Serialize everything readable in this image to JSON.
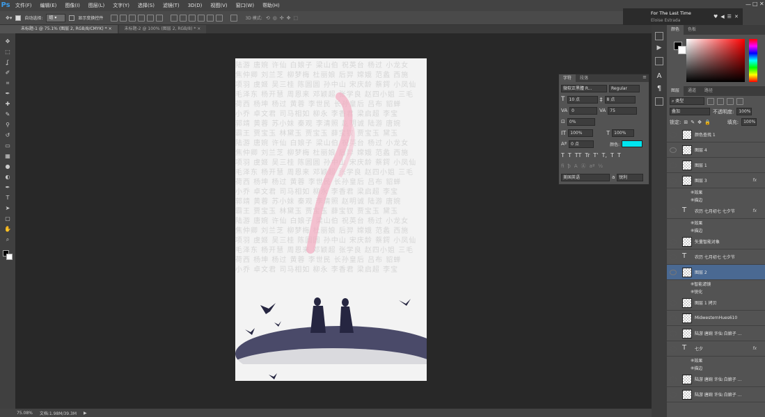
{
  "app_logo": "Ps",
  "menu": [
    "文件(F)",
    "编辑(E)",
    "图像(I)",
    "图层(L)",
    "文字(Y)",
    "选择(S)",
    "滤镜(T)",
    "3D(D)",
    "视图(V)",
    "窗口(W)",
    "帮助(H)"
  ],
  "options": {
    "auto_select_label": "自动选择:",
    "auto_select_value": "组",
    "transform_label": "显示变换控件",
    "mode3d_label": "3D 模式:"
  },
  "media": {
    "title": "For The Last Time",
    "artist": "Eloise Estrada"
  },
  "tabs": [
    {
      "label": "未标题-1 @ 75.1% (图层 2, RGB/8/CMYK) *",
      "close": "×"
    },
    {
      "label": "未标题-2 @ 100% (图层 2, RGB/8) *",
      "close": "×"
    }
  ],
  "doc_text_lines": [
    "陆游 唐婉 许仙 白娘子 梁山伯 祝英台 杨过 小龙女",
    "焦仲卿 刘兰芝 柳梦梅 杜丽娘 后羿 嫦娥 范蠡 西施",
    "项羽 虞姬 吴三桂 陈圆圆 孙中山 宋庆龄 蔡鍔 小凤仙",
    "毛泽东 杨开慧 周恩来 邓颖超 张学良 赵四小姐 三毛",
    "荷西 杨坤 杨过 黄蓉 李世民 长孙皇后 吕布 貂蝉",
    "小乔 卓文君 司马相如 柳永 李香君 梁启超 李宝",
    "郭靖 黄蓉 苏小妹 秦观 李清照 赵明诚 陆游 唐婉",
    "霸王 贾宝玉 林黛玉 贾宝玉 薛宝钗 贾宝玉 黛玉",
    "陆游 唐婉 许仙 白娘子 梁山伯 祝英台 杨过 小龙女",
    "焦仲卿 刘兰芝 柳梦梅 杜丽娘 后羿 嫦娥 范蠡 西施",
    "项羽 虞姬 吴三桂 陈圆圆 孙中山 宋庆龄 蔡鍔 小凤仙",
    "毛泽东 杨开慧 周恩来 邓颖超 张学良 赵四小姐 三毛",
    "荷西 杨坤 杨过 黄蓉 李世民 长孙皇后 吕布 貂蝉",
    "小乔 卓文君 司马相如 柳永 李香君 梁启超 李宝",
    "郭靖 黄蓉 苏小妹 秦观 李清照 赵明诚 陆游 唐婉",
    "霸王 贾宝玉 林黛玉 贾宝玉 薛宝钗 贾宝玉 黛玉",
    "陆游 唐婉 许仙 白娘子 梁山伯 祝英台 杨过 小龙女",
    "焦仲卿 刘兰芝 柳梦梅 杜丽娘 后羿 嫦娥 范蠡 西施",
    "项羽 虞姬 吴三桂 陈圆圆 孙中山 宋庆龄 蔡鍔 小凤仙",
    "毛泽东 杨开慧 周恩来 邓颖超 张学良 赵四小姐 三毛",
    "荷西 杨坤 杨过 黄蓉 李世民 长孙皇后 吕布 貂蝉",
    "小乔 卓文君 司马相如 柳永 李香君 梁启超 李宝"
  ],
  "status": {
    "zoom": "75.08%",
    "doc_size": "文档:1.98M/39.3M"
  },
  "character_panel": {
    "tabs": [
      "字符",
      "段落"
    ],
    "font_family": "微软正黑體 R...",
    "font_style": "Regular",
    "font_size": "10 点",
    "leading": "8 点",
    "kerning": "0",
    "tracking": "75",
    "scale_percent": "0%",
    "vertical_scale": "100%",
    "horizontal_scale": "100%",
    "baseline": "0 点",
    "color_label": "颜色:",
    "color_value": "#00e5f0",
    "language": "美国英语",
    "aa_label": "a",
    "aa_value": "锐利",
    "text_style_buttons": [
      "T",
      "T",
      "TT",
      "Tr",
      "T'",
      "T,",
      "T",
      "T"
    ]
  },
  "color_panel": {
    "tabs": [
      "颜色",
      "色板"
    ]
  },
  "layers_panel": {
    "tabs": [
      "图层",
      "通道",
      "路径"
    ],
    "filter_label": "类型",
    "blend_mode": "叠加",
    "opacity_label": "不透明度:",
    "opacity": "100%",
    "lock_label": "锁定:",
    "fill_label": "填充:",
    "fill": "100%",
    "layers": [
      {
        "name": "颜色查找 1",
        "visible": false,
        "type": "adjust",
        "fx": ""
      },
      {
        "name": "图层 4",
        "visible": true,
        "type": "raster",
        "fx": ""
      },
      {
        "name": "图层 1",
        "visible": false,
        "type": "raster",
        "fx": ""
      },
      {
        "name": "图层 3",
        "visible": false,
        "type": "raster",
        "fx": "fx"
      },
      {
        "name": "效果",
        "sub": true
      },
      {
        "name": "描边",
        "sub": true
      },
      {
        "name": "农历 七月初七 七夕节",
        "visible": false,
        "type": "text",
        "fx": "fx"
      },
      {
        "name": "效果",
        "sub": true
      },
      {
        "name": "描边",
        "sub": true
      },
      {
        "name": "矢量智能对象",
        "visible": false,
        "type": "smart",
        "fx": ""
      },
      {
        "name": "农历 七月初七 七夕节",
        "visible": false,
        "type": "text",
        "fx": ""
      },
      {
        "name": "图层 2",
        "visible": true,
        "type": "raster",
        "fx": "",
        "selected": true
      },
      {
        "name": "智能滤镜",
        "sub": true
      },
      {
        "name": "锐化",
        "sub": true
      },
      {
        "name": "图层 1 拷贝",
        "visible": false,
        "type": "raster",
        "fx": ""
      },
      {
        "name": "MidwesternHues610",
        "visible": false,
        "type": "raster",
        "fx": ""
      },
      {
        "name": "陆游 唐婉 许仙 白娘子 ...",
        "visible": false,
        "type": "raster",
        "fx": ""
      },
      {
        "name": "七夕",
        "visible": false,
        "type": "text",
        "fx": "fx"
      },
      {
        "name": "效果",
        "sub": true
      },
      {
        "name": "描边",
        "sub": true
      },
      {
        "name": "陆游 唐婉 许仙 白娘子 ...",
        "visible": false,
        "type": "raster",
        "fx": ""
      },
      {
        "name": "陆游 唐婉 许仙 白娘子 ...",
        "visible": false,
        "type": "raster",
        "fx": ""
      }
    ]
  },
  "tools": [
    "move",
    "marquee",
    "lasso",
    "quick-select",
    "crop",
    "eyedropper",
    "spot-heal",
    "brush",
    "stamp",
    "history-brush",
    "eraser",
    "gradient",
    "blur",
    "dodge",
    "pen",
    "type",
    "path-select",
    "shape",
    "hand",
    "zoom"
  ]
}
